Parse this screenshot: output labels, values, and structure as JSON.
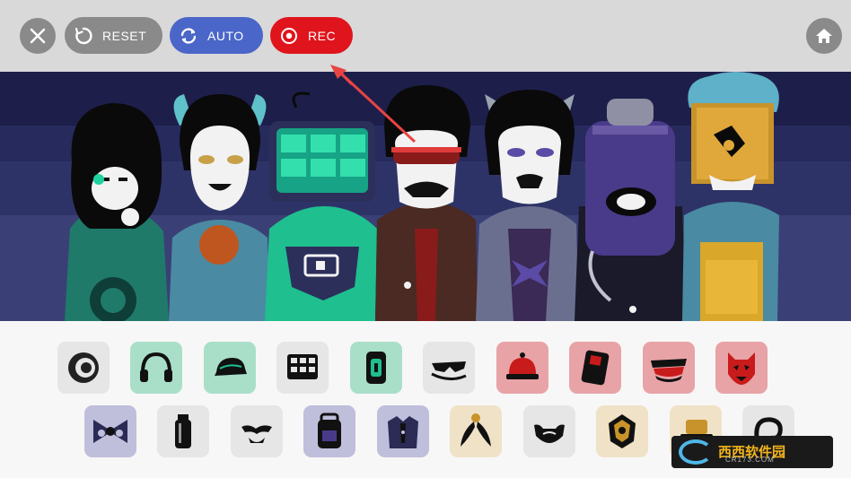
{
  "topbar": {
    "close_icon": "close-icon",
    "reset_label": "RESET",
    "auto_label": "AUTO",
    "rec_label": "REC",
    "home_icon": "home-icon",
    "colors": {
      "bar": "#d9d9d9",
      "grey": "#8a8a8a",
      "auto": "#4a66c8",
      "rec": "#e0141c"
    }
  },
  "annotation": {
    "icon": "red-arrow-pointing-to-rec"
  },
  "stage": {
    "characters": [
      "character-1-hooded-teal",
      "character-2-green-haired-girl",
      "character-3-robot-screen",
      "character-4-sunglasses-brown-jacket",
      "character-5-cat-ears-purple",
      "character-6-purple-canister",
      "character-7-yellow-box-head"
    ]
  },
  "tray": {
    "row1": [
      {
        "icon": "swirl-sound-icon",
        "bg": "#e6e6e6"
      },
      {
        "icon": "headphones-icon",
        "bg": "#a9dfc9"
      },
      {
        "icon": "cap-icon",
        "bg": "#a9dfc9"
      },
      {
        "icon": "grid-screen-icon",
        "bg": "#e6e6e6"
      },
      {
        "icon": "phone-icon",
        "bg": "#a9dfc9"
      },
      {
        "icon": "sunglasses-icon",
        "bg": "#e6e6e6"
      },
      {
        "icon": "bell-icon",
        "bg": "#e8a3a6"
      },
      {
        "icon": "device-icon",
        "bg": "#e8a3a6"
      },
      {
        "icon": "lips-icon",
        "bg": "#e8a3a6"
      },
      {
        "icon": "cat-mask-icon",
        "bg": "#e8a3a6"
      }
    ],
    "row2": [
      {
        "icon": "bowtie-icon",
        "bg": "#bfbedb"
      },
      {
        "icon": "bottle-icon",
        "bg": "#e6e6e6"
      },
      {
        "icon": "mustache-icon",
        "bg": "#e6e6e6"
      },
      {
        "icon": "backpack-icon",
        "bg": "#bfbedb"
      },
      {
        "icon": "jacket-icon",
        "bg": "#bfbedb"
      },
      {
        "icon": "feathers-icon",
        "bg": "#efe2c7"
      },
      {
        "icon": "beard-icon",
        "bg": "#e6e6e6"
      },
      {
        "icon": "mask-icon",
        "bg": "#efe2c7"
      },
      {
        "icon": "hat-icon",
        "bg": "#efe2c7"
      },
      {
        "icon": "spiral-icon",
        "bg": "#e6e6e6"
      }
    ]
  },
  "watermark": {
    "text": "西西软件园",
    "sub": "CR173.COM"
  }
}
